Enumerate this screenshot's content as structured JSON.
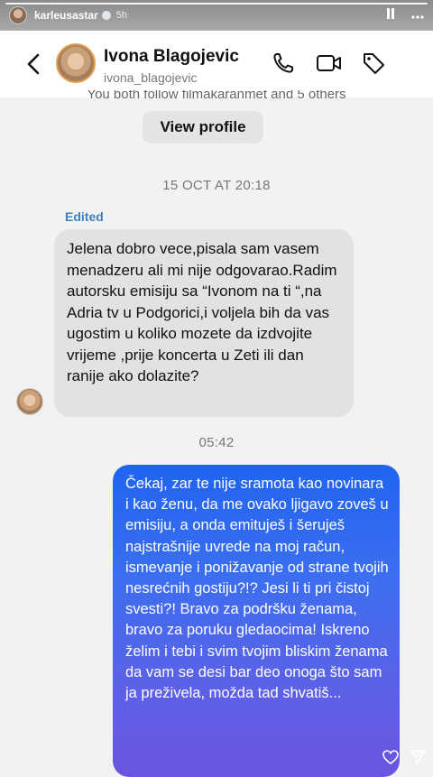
{
  "story": {
    "username": "karleusastar",
    "time": "5h"
  },
  "chat": {
    "header": {
      "name": "Ivona Blagojevic",
      "handle": "ivona_blagojevic"
    },
    "follow_text": "You both follow filmakaranmet and 5 others",
    "view_profile_label": "View profile",
    "date_stamp": "15 OCT AT 20:18",
    "edited_label": "Edited",
    "incoming_message": "Jelena dobro vece,pisala sam vasem menadzeru ali mi nije odgovarao.Radim autorsku emisiju sa “Ivonom na ti “,na Adria tv u Podgorici,i voljela bih da vas ugostim u koliko mozete da izdvojite vrijeme ,prije koncerta u Zeti ili dan ranije ako dolazite?",
    "reply_time": "05:42",
    "outgoing_message": "Čekaj, zar te nije sramota kao novinara i kao ženu, da me ovako ljigavo zoveš u emisiju, a onda emituješ i šeruješ najstrašnije uvrede na moj račun, ismevanje i ponižavanje od strane tvojih nesrećnih gostiju?!? Jesi li ti pri čistoj svesti?! Bravo za podršku ženama, bravo za poruku gledaocima! Iskreno želim i tebi i svim tvojim bliskim ženama da vam se desi bar deo onoga što sam ja preživela, možda tad shvatiš..."
  },
  "colors": {
    "outgoing_bubble": "#3b6ef0",
    "incoming_bubble": "#e2e2e2",
    "edited_label": "#3b82c4"
  },
  "icons": [
    "back-arrow-icon",
    "phone-icon",
    "video-camera-icon",
    "tag-icon",
    "pause-icon",
    "more-icon",
    "heart-icon",
    "send-icon"
  ]
}
